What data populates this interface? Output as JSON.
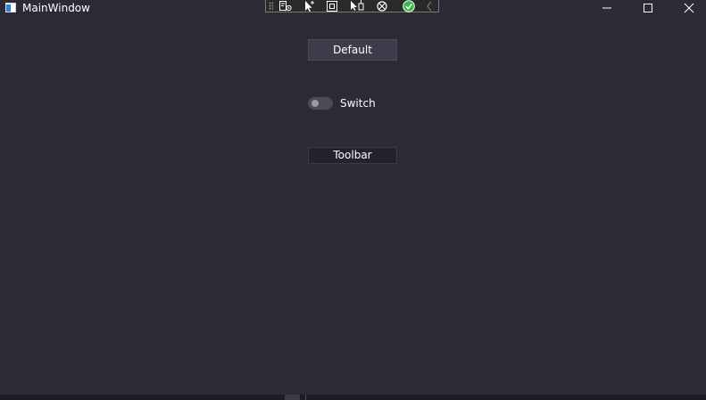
{
  "window": {
    "title": "MainWindow",
    "controls": [
      "minimize-icon",
      "maximize-icon",
      "close-icon"
    ]
  },
  "debug_toolbar": {
    "icons": [
      "settings-list-icon",
      "pointer-select-icon",
      "frame-select-icon",
      "pointer-move-icon",
      "refresh-icon",
      "check-icon",
      "collapse-chevron-icon"
    ]
  },
  "content": {
    "default_button_label": "Default",
    "switch_label": "Switch",
    "switch_on": false,
    "toolbar_button_label": "Toolbar"
  },
  "colors": {
    "background": "#2b2b36",
    "button_bg": "#3c3c4b",
    "check_green": "#3cb84a"
  }
}
